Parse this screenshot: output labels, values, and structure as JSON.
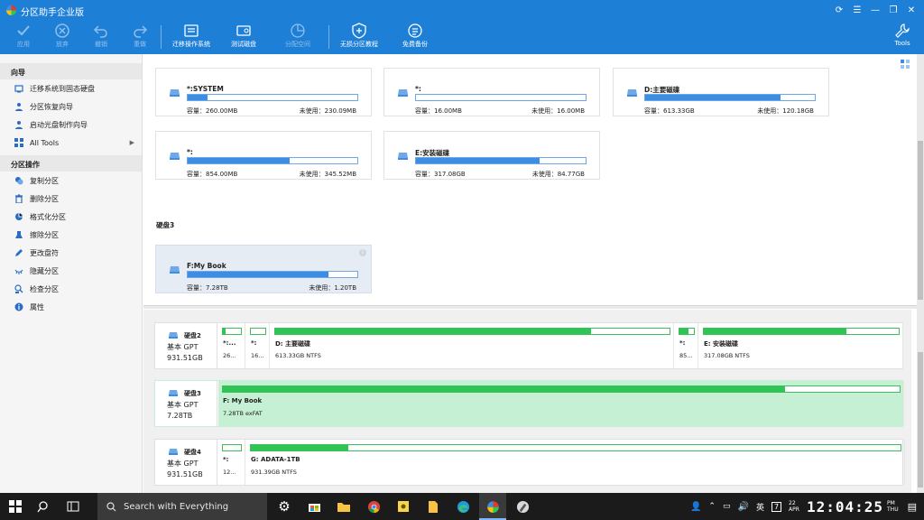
{
  "window": {
    "title": "分区助手企业版"
  },
  "toolbar": {
    "apply": "应用",
    "discard": "放弃",
    "undo": "撤销",
    "redo": "重做",
    "migrate": "迁移操作系统",
    "test_disk": "测试磁盘",
    "allocate": "分配空间",
    "lossless_tutorial": "无损分区教程",
    "free_backup": "免费备份",
    "tools": "Tools"
  },
  "sidebar": {
    "wizard_header": "向导",
    "wizard_items": [
      {
        "label": "迁移系统到固态硬盘",
        "icon": "migrate-icon"
      },
      {
        "label": "分区恢复向导",
        "icon": "recovery-icon"
      },
      {
        "label": "启动光盘制作向导",
        "icon": "bootdisk-icon"
      },
      {
        "label": "All Tools",
        "icon": "grid-icon"
      }
    ],
    "ops_header": "分区操作",
    "ops_items": [
      {
        "label": "复制分区",
        "icon": "copy-icon"
      },
      {
        "label": "删除分区",
        "icon": "trash-icon"
      },
      {
        "label": "格式化分区",
        "icon": "format-icon"
      },
      {
        "label": "擦除分区",
        "icon": "wipe-icon"
      },
      {
        "label": "更改盘符",
        "icon": "edit-icon"
      },
      {
        "label": "隐藏分区",
        "icon": "hide-icon"
      },
      {
        "label": "检查分区",
        "icon": "check-icon"
      },
      {
        "label": "属性",
        "icon": "info-icon"
      }
    ]
  },
  "cards": [
    {
      "name": "*:SYSTEM",
      "used_fraction": 0.115,
      "capacity": "容量：260.00MB",
      "free": "未使用：230.09MB"
    },
    {
      "name": "*:",
      "used_fraction": 0.0,
      "capacity": "容量：16.00MB",
      "free": "未使用：16.00MB"
    },
    {
      "name": "D:主要磁碟",
      "used_fraction": 0.8,
      "capacity": "容量：613.33GB",
      "free": "未使用：120.18GB"
    },
    {
      "name": "*:",
      "used_fraction": 0.6,
      "capacity": "容量：854.00MB",
      "free": "未使用：345.52MB"
    },
    {
      "name": "E:安装磁碟",
      "used_fraction": 0.73,
      "capacity": "容量：317.08GB",
      "free": "未使用：84.77GB"
    }
  ],
  "disk3_section": {
    "label": "硬盘3",
    "card": {
      "name": "F:My Book",
      "used_fraction": 0.83,
      "capacity": "容量：7.28TB",
      "free": "未使用：1.20TB"
    }
  },
  "disks": [
    {
      "name": "硬盘2",
      "type": "基本 GPT",
      "size": "931.51GB",
      "parts": [
        {
          "name": "*:...",
          "info": "26...",
          "fill": 0.15
        },
        {
          "name": "*:",
          "info": "16...",
          "fill": 0.0
        },
        {
          "name": "D: 主要磁碟",
          "info": "613.33GB NTFS",
          "fill": 0.8
        },
        {
          "name": "*:",
          "info": "85...",
          "fill": 0.6
        },
        {
          "name": "E: 安装磁碟",
          "info": "317.08GB NTFS",
          "fill": 0.73
        }
      ]
    },
    {
      "name": "硬盘3",
      "type": "基本 GPT",
      "size": "7.28TB",
      "parts": [
        {
          "name": "F: My Book",
          "info": "7.28TB exFAT",
          "fill": 0.83
        }
      ]
    },
    {
      "name": "硬盘4",
      "type": "基本 GPT",
      "size": "931.51GB",
      "parts": [
        {
          "name": "*:",
          "info": "12...",
          "fill": 0.0
        },
        {
          "name": "G: ADATA-1TB",
          "info": "931.39GB NTFS",
          "fill": 0.15
        }
      ]
    }
  ],
  "taskbar": {
    "search_placeholder": "Search with Everything",
    "tray_lang": "英",
    "tray_date_top": "22",
    "tray_date_bottom": "APR",
    "clock": "12:04:25",
    "clock_ampm": "PM",
    "clock_day": "THU"
  },
  "colors": {
    "accent": "#1e7fd7",
    "bar_blue": "#3d8ee3",
    "bar_green": "#2fc555",
    "selected_green": "#c6f0d4"
  }
}
